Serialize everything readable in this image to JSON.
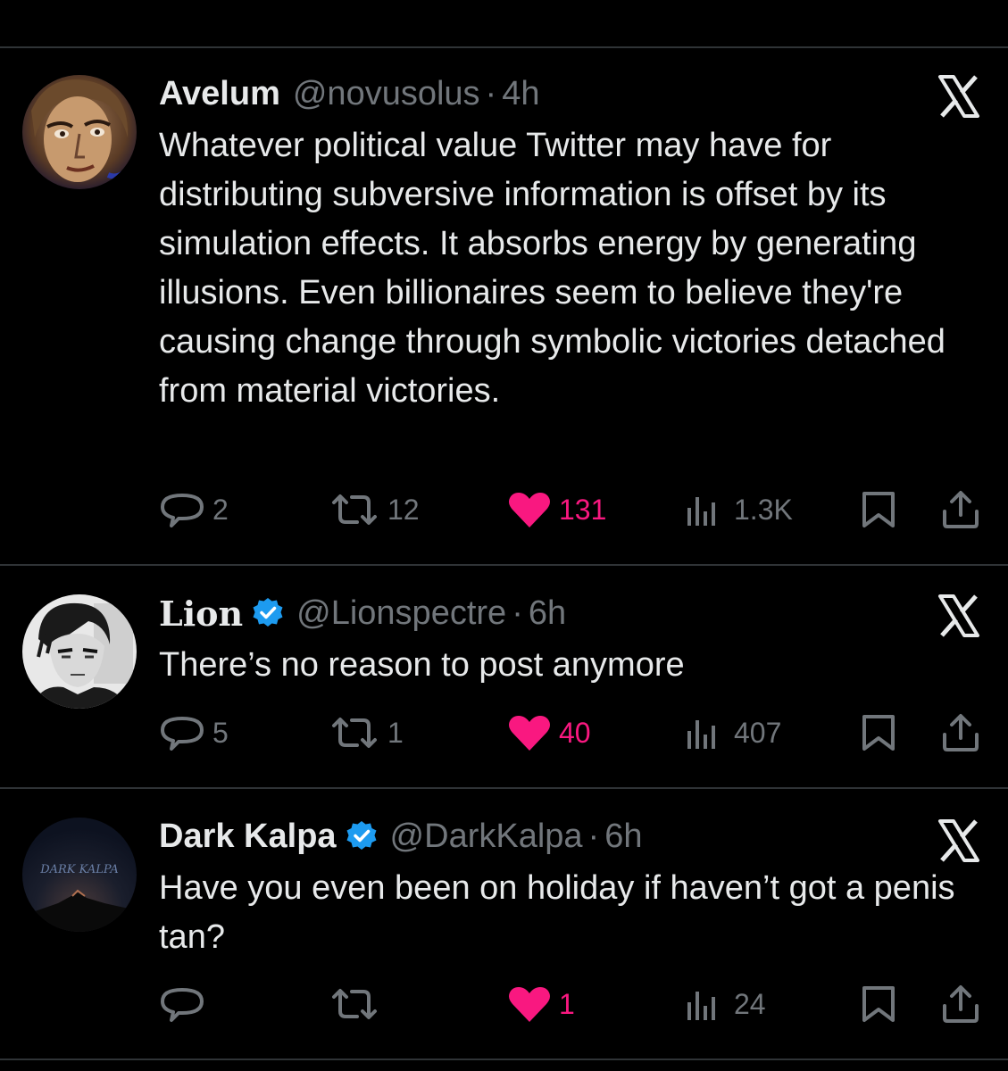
{
  "tweets": [
    {
      "name": "Avelum",
      "handle": "@novusolus",
      "time": "4h",
      "verified": false,
      "text": "Whatever political value Twitter may have for distributing subversive information is offset by its simulation effects. It absorbs energy by generating illusions. Even billionaires seem to believe they're causing change through symbolic victories detached from material victories.",
      "replies": "2",
      "reposts": "12",
      "likes": "131",
      "views": "1.3K",
      "liked": true
    },
    {
      "name": "Lion",
      "handle": "@Lionspectre",
      "time": "6h",
      "verified": true,
      "text": "There’s no reason to post anymore",
      "replies": "5",
      "reposts": "1",
      "likes": "40",
      "views": "407",
      "liked": true
    },
    {
      "name": "Dark Kalpa",
      "handle": "@DarkKalpa",
      "time": "6h",
      "verified": true,
      "text": "Have you even been on holiday if haven’t got a penis tan?",
      "avatar_text": "DARK KALPA",
      "replies": "",
      "reposts": "",
      "likes": "1",
      "views": "24",
      "liked": true
    }
  ],
  "meta": {
    "separator": "·"
  },
  "icons": {
    "reply": "reply-icon",
    "repost": "repost-icon",
    "like": "heart-icon",
    "views": "views-icon",
    "bookmark": "bookmark-icon",
    "share": "share-icon",
    "close": "x-logo-icon",
    "verified": "verified-badge-icon"
  },
  "colors": {
    "background": "#000000",
    "text": "#e7e9ea",
    "muted": "#71767b",
    "like": "#f91880",
    "verified": "#1d9bf0",
    "divider": "#2f3336"
  }
}
